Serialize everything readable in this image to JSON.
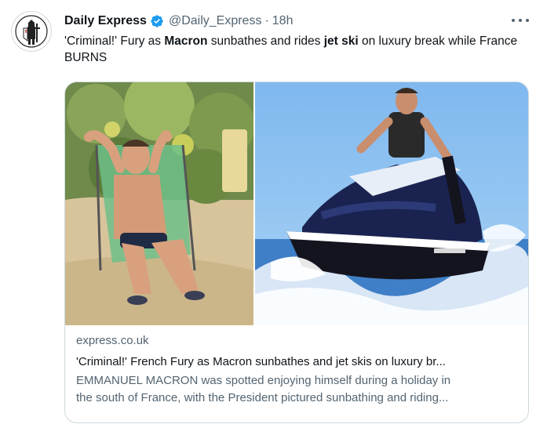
{
  "tweet": {
    "account_name": "Daily Express",
    "handle": "@Daily_Express",
    "separator": "·",
    "time": "18h",
    "text": {
      "part1": "'Criminal!' Fury as ",
      "bold1": "Macron",
      "part2": " sunbathes and rides ",
      "bold2": "jet ski",
      "part3": " on luxury break while France BURNS"
    }
  },
  "card": {
    "domain": "express.co.uk",
    "title": "'Criminal!' French Fury as Macron sunbathes and jet skis on luxury br...",
    "description_line1": "EMMANUEL MACRON was spotted enjoying himself during a holiday in",
    "description_line2": "the south of France, with the President pictured sunbathing and riding..."
  },
  "icons": {
    "avatar": "crusader-knight-logo-icon",
    "verified": "verified-badge-icon",
    "more": "more-options-icon"
  },
  "colors": {
    "text_primary": "#0f1419",
    "text_secondary": "#536471",
    "verified_blue": "#1d9bf0",
    "border": "#cfd9de"
  }
}
